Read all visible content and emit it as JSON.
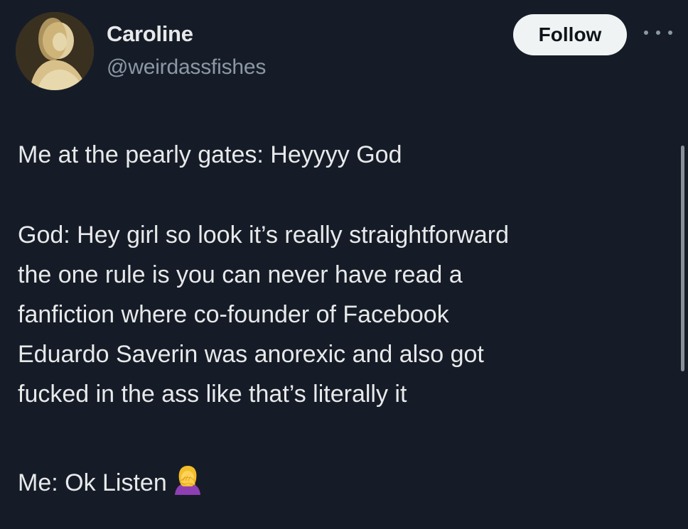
{
  "author": {
    "display_name": "Caroline",
    "handle": "@weirdassfishes",
    "avatar_icon": "avatar-portrait"
  },
  "actions": {
    "follow_label": "Follow",
    "more_icon": "more-horizontal-icon"
  },
  "tweet": {
    "paragraph_1": [
      "Me at the pearly gates: Heyyyy God"
    ],
    "paragraph_2": [
      "God: Hey girl so look it’s really straightforward",
      "the one rule is you can never have read a",
      "fanfiction where co-founder of Facebook",
      "Eduardo Saverin was anorexic and also got",
      "fucked in the ass like that’s literally it"
    ],
    "paragraph_3": "Me: Ok Listen",
    "paragraph_3_emoji": "facepalm-woman-emoji"
  },
  "colors": {
    "background": "#161c27",
    "text": "#e7e9ea",
    "secondary_text": "#8b98a5",
    "follow_button_bg": "#eff3f4"
  }
}
